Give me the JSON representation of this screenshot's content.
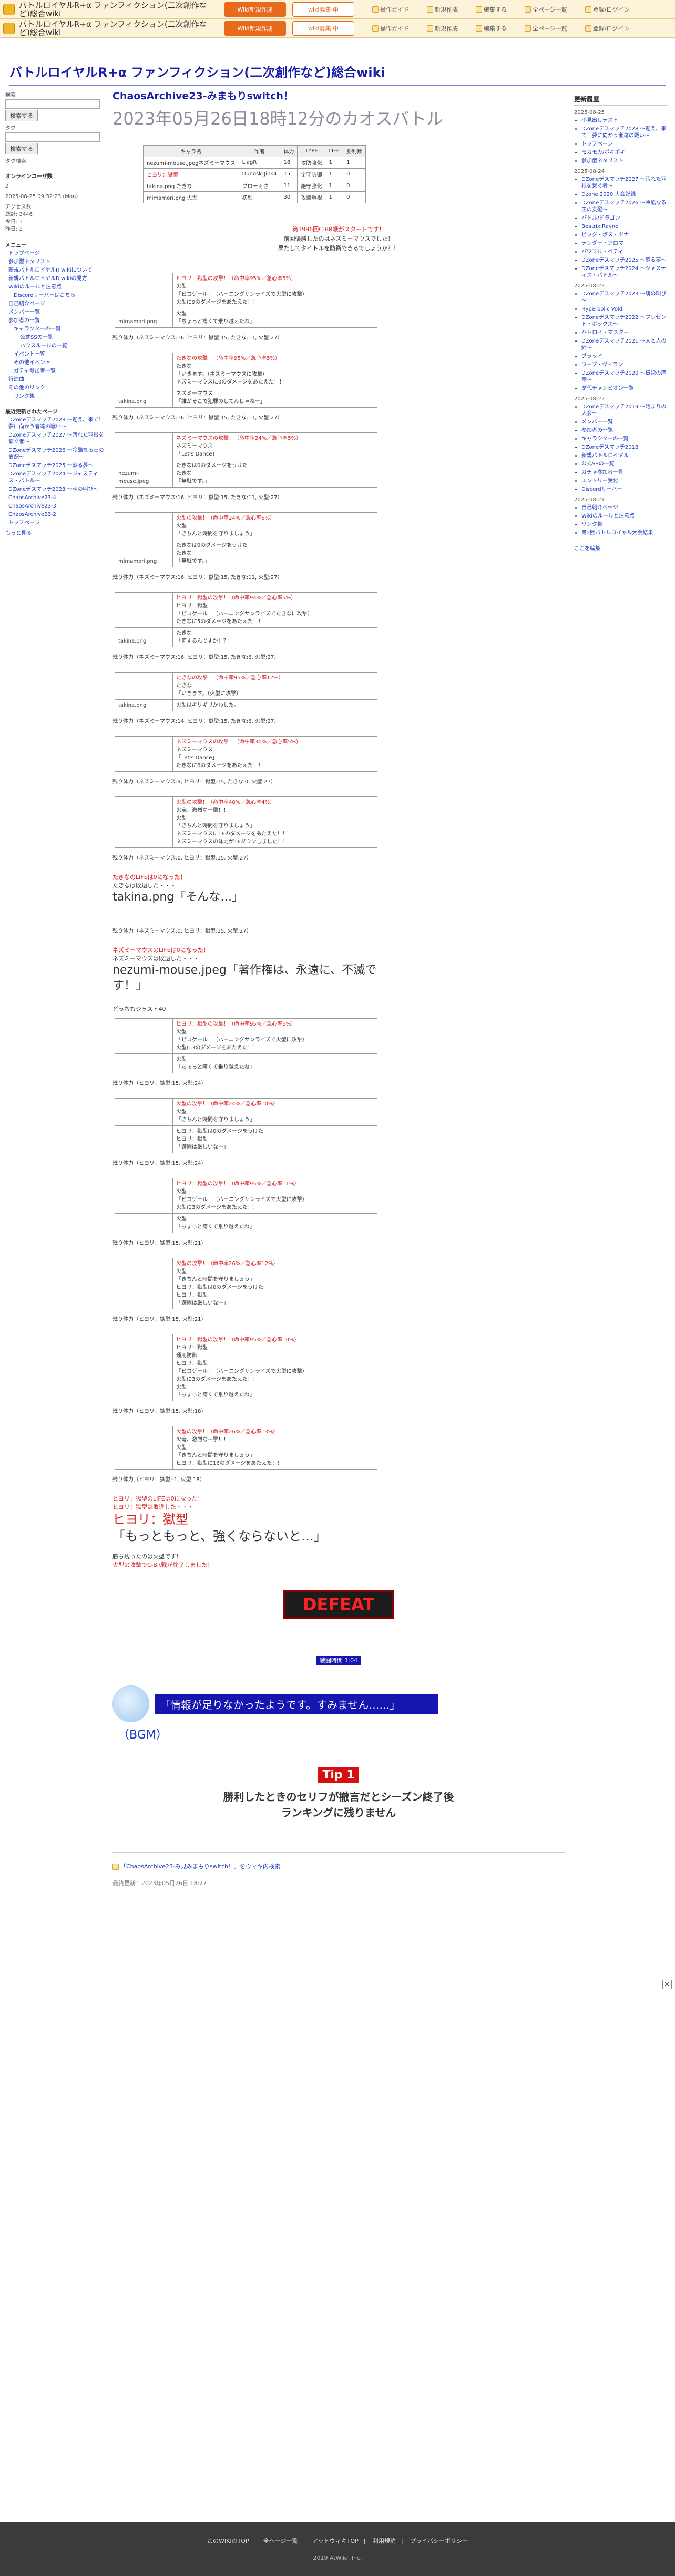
{
  "topbar": {
    "site_title": "バトルロイヤルR+α ファンフィクション(二次創作など)総合wiki",
    "tab1": "Wiki新規作成",
    "tab2": "wiki募集 中",
    "tab3": "登録/ログイン",
    "tools": [
      "操作ガイド",
      "新規作成",
      "編集する",
      "全ページ一覧",
      "登録/ログイン"
    ]
  },
  "wiki_title": "バトルロイヤルR+α ファンフィクション(二次創作など)総合wiki",
  "left": {
    "search_label": "検索",
    "search_button": "検索する",
    "filter_label": "タグ",
    "filter_button": "検索する",
    "tag_search": "タグ検索",
    "online_label": "オンラインユーザ数",
    "online_value": "2",
    "updated": "2025-08-25 09:32:23 (Mon)",
    "stats": [
      "アクセス数",
      "総計: 3446",
      "今日: 1",
      "昨日: 2"
    ],
    "menu_title": "メニュー",
    "menu": [
      "トップページ",
      "参加型ネタリスト",
      "新規バトルロイヤルR wikiについて",
      "新規バトルロイヤルR wikiの見方",
      "Wikiのルールと注意点",
      "Discordサーバーはこちら",
      "自己紹介ページ",
      "メンバー一覧",
      "参加者の一覧",
      "キャラクターの一覧",
      "公式SSの一覧",
      "ハウスルールの一覧",
      "イベント一覧",
      "その他イベント",
      "ガチャ参加者一覧",
      "行進曲",
      "その他のリンク",
      "リンク集"
    ],
    "recent_title": "最近更新されたページ",
    "recent": [
      "DZoneデスマッチ2028 ～迎え、来て！夢に向かう者達の戦い～",
      "DZoneデスマッチ2027 ～汚れた羽根を繋ぐ者～",
      "DZoneデスマッチ2026 ～冷酷なる王の支配～",
      "DZoneデスマッチ2025 ～蘇る夢～",
      "DZoneデスマッチ2024 ～ジャスティス・バトル～",
      "DZoneデスマッチ2023 ～魂の叫び～",
      "ChaosArchive23-4",
      "ChaosArchive23-3",
      "ChaosArchive23-2",
      "トップページ"
    ],
    "more": "もっと見る"
  },
  "right": {
    "head": "更新履歴",
    "groups": [
      {
        "date": "2025-08-25",
        "items": [
          "小見出しテスト",
          "DZoneデスマッチ2028 ～迎え、来て！夢に向かう者達の戦い～",
          "トップページ",
          "モカモカ/ポキポキ",
          "参加型ネタリスト"
        ]
      },
      {
        "date": "2025-08-24",
        "items": [
          "DZoneデスマッチ2027 ～汚れた羽根を繋ぐ者～",
          "Dzone 2020 大会記録",
          "DZoneデスマッチ2026 ～冷酷なる王の支配～",
          "バトル/ドラゴン",
          "Beatrix Rayne",
          "ビッグ・ボス・ツナ",
          "テンダー・アロマ",
          "パワフル・ペティ",
          "DZoneデスマッチ2025 ～蘇る夢～",
          "DZoneデスマッチ2024 ～ジャスティス・バトル～"
        ]
      },
      {
        "date": "2025-08-23",
        "items": [
          "DZoneデスマッチ2023 ～魂の叫び～",
          "Hyperbolic Void",
          "DZoneデスマッチ2022 ～プレゼント・ボックス～",
          "バトロイ・マスター",
          "DZoneデスマッチ2021 ～人と人の絆～",
          "ブラッド",
          "ワープ・ヴィラン",
          "DZoneデスマッチ2020 ～伝説の序章～",
          "歴代チャンピオン一覧"
        ]
      },
      {
        "date": "2025-08-22",
        "items": [
          "DZoneデスマッチ2019 ～始まりの大会～",
          "メンバー一覧",
          "参加者の一覧",
          "キャラクターの一覧",
          "DZoneデスマッチ2018",
          "新規バトルロイヤル",
          "公式SSの一覧",
          "ガチャ参加者一覧",
          "エントリー受付",
          "Discordサーバー"
        ]
      },
      {
        "date": "2025-08-21",
        "items": [
          "自己紹介ページ",
          "Wikiのルールと注意点",
          "リンク集",
          "第2回バトルロイヤル大会結果"
        ]
      }
    ],
    "edit_link": "ここを編集"
  },
  "main": {
    "page_title": "ChaosArchive23-みまもりswitch！",
    "page_subtitle": "2023年05月26日18時12分のカオスバトル",
    "stat_headers": [
      "キャラ名",
      "作者",
      "体力",
      "TYPE",
      "LIFE",
      "勝利数"
    ],
    "stat_rows": [
      [
        "nezumi-mouse.jpegネズミーマウス",
        "LiagR",
        "18",
        "攻防強化",
        "1",
        "1"
      ],
      [
        "ヒヨリ：獄型",
        "Dunosk-Jink4",
        "15",
        "全守防御",
        "1",
        "0"
      ],
      [
        "takina.png たきな",
        "プロテぇさ",
        "11",
        "絶守強化",
        "1",
        "0"
      ],
      [
        "mimamori.png 火型",
        "初型",
        "30",
        "攻撃重視",
        "1",
        "0"
      ]
    ],
    "intro": [
      "第1996回C-BR戦がスタートです！",
      "前回優勝したのはネズミーマウスでした！",
      "果たしてタイトルを防衛できるでしょうか？！"
    ],
    "hp_lines": [
      "残り体力（ネズミーマウス:16, ヒヨリ：獄型:15, たきな:11, 火型:27）",
      "残り体力（ネズミーマウス:16, ヒヨリ：獄型:15, たきな:11, 火型:27）",
      "残り体力（ネズミーマウス:16, ヒヨリ：獄型:15, たきな:11, 火型:27）",
      "残り体力（ネズミーマウス:16, ヒヨリ：獄型:15, たきな:11, 火型:27）",
      "残り体力（ネズミーマウス:16, ヒヨリ：獄型:15, たきな:6, 火型:27）",
      "残り体力（ネズミーマウス:14, ヒヨリ：獄型:15, たきな:6, 火型:27）",
      "残り体力（ネズミーマウス:9, ヒヨリ：獄型:15, たきな:0, 火型:27）",
      "残り体力（ネズミーマウス:0, ヒヨリ：獄型:15, 火型:27）",
      "残り体力（ヒヨリ：獄型:15, 火型:24）",
      "残り体力（ヒヨリ：獄型:15, 火型:24）",
      "残り体力（ヒヨリ：獄型:15, 火型:21）",
      "残り体力（ヒヨリ：獄型:15, 火型:21）",
      "残り体力（ヒヨリ：獄型:15, 火型:18）",
      "残り体力（ヒヨリ：獄型:-1, 火型:18）"
    ],
    "turns": [
      {
        "lines": [
          "ヒヨリ：獄型の攻撃！（命中率95%／急心率5%）",
          "火型",
          "「ピコゲール！（ハーニングサンライズで火型に攻撃）",
          "火型に9のダメージをあたえた！！"
        ],
        "speaker": "mimamori.png",
        "reply": [
          "火型",
          "「ちょっと痛くて乗り越えたね」"
        ]
      },
      {
        "lines": [
          "たきなの攻撃！（命中率95%／急心率5%）",
          "たきな",
          "「いきます。（ネズミーマウスに攻撃）",
          "ネズミーマウスに0のダメージをあたえた！！"
        ],
        "speaker": "takina.png",
        "reply": [
          "ネズミーマウス",
          "「誰がそこで犯罪のしてんじゃねー」"
        ]
      },
      {
        "lines": [
          "ネズミーマウスの攻撃！（命中率24%／急心率5%）",
          "ネズミーマウス",
          "「Let's Dance」"
        ],
        "speaker": "nezumi-mouse.jpeg",
        "reply": [
          "たきなは0のダメージをうけた",
          "たきな",
          "「無駄です。」"
        ]
      },
      {
        "lines": [
          "火型の攻撃！（命中率24%／急心率5%）",
          "火型",
          "「きちんと時間を守りましょう」"
        ],
        "speaker": "mimamori.png",
        "reply": [
          "たきなは0のダメージをうけた",
          "たきな",
          "「無駄です。」"
        ]
      },
      {
        "lines": [
          "ヒヨリ：獄型の攻撃！（命中率94%／急心率5%）",
          "ヒヨリ：獄型",
          "「ピコゲール！（ハーニングサンライズでたきなに攻撃）",
          "たきなに5のダメージをあたえた！！"
        ],
        "speaker": "takina.png",
        "reply": [
          "たきな",
          "「何するんですか！？」"
        ]
      },
      {
        "lines": [
          "たきなの攻撃！（命中率95%／急心率12%）",
          "たきな",
          "「いきます。（火型に攻撃）"
        ],
        "speaker": "takina.png",
        "reply": [
          "火型はギリギリかわした。"
        ]
      },
      {
        "lines": [
          "ネズミーマウスの攻撃！（命中率30%／急心率5%）",
          "ネズミーマウス",
          "「Let's Dance」",
          "たきなに6のダメージをあたえた！！"
        ],
        "speaker": "nezumi-mouse.jpeg",
        "reply": []
      },
      {
        "lines": [
          "火型の攻撃！（命中率48%／急心率4%）",
          "火竜、激烈な一撃！！！",
          "火型",
          "「きちんと時間を守りましょう」",
          "ネズミーマウスに16のダメージをあたえた！！",
          "ネズミーマウスの体力が16ダウンしました！！"
        ],
        "speaker": "mimamori.png",
        "reply": []
      }
    ],
    "takina_out": [
      "たきなのLIFEは0になった！",
      "たきなは敗退した・・・"
    ],
    "takina_last": "takina.png「そんな…」",
    "mouse_out": [
      "ネズミーマウスのLIFEは0になった！",
      "ネズミーマウスは敗退した・・・"
    ],
    "mouse_last": "nezumi-mouse.jpeg「著作権は、永遠に、不滅です！」",
    "duel_label": "どっちもジャスト40",
    "duel_turns": [
      {
        "lines": [
          "ヒヨリ：獄型の攻撃！（命中率95%／急心率5%）",
          "火型",
          "「ピコゲール！（ハーニングサンライズで火型に攻撃）",
          "火型に3のダメージをあたえた！！"
        ],
        "reply": [
          "火型",
          "「ちょっと痛くて乗り越えたね」"
        ]
      },
      {
        "lines": [
          "火型の攻撃！（命中率24%／急心率10%）",
          "火型",
          "「きちんと時間を守りましょう」"
        ],
        "reply": [
          "ヒヨリ：獄型は0のダメージをうけた",
          "ヒヨリ：獄型",
          "「遊園は厳しいなー」"
        ]
      },
      {
        "lines": [
          "ヒヨリ：獄型の攻撃！（命中率95%／急心率11%）",
          "火型",
          "「ピコゲール！（ハーニングサンライズで火型に攻撃）",
          "火型に3のダメージをあたえた！！"
        ],
        "reply": [
          "火型",
          "「ちょっと痛くて乗り越えたね」"
        ]
      },
      {
        "lines": [
          "火型の攻撃！（命中率26%／急心率12%）",
          "火型",
          "「きちんと時間を守りましょう」",
          "ヒヨリ：獄型は0のダメージをうけた",
          "ヒヨリ：獄型",
          "「遊園は厳しいなー」"
        ],
        "reply": []
      },
      {
        "lines": [
          "ヒヨリ：獄型の攻撃！（命中率95%／急心率10%）",
          "ヒヨリ：獄型",
          "通用防御",
          "ヒヨリ：獄型",
          "「ピコゲール！（ハーニングサンライズで火型に攻撃）",
          "火型に3のダメージをあたえた！！",
          "火型",
          "「ちょっと痛くて乗り越えたね」"
        ],
        "reply": []
      },
      {
        "lines": [
          "火型の攻撃！（命中率26%／急心率13%）",
          "火竜、激烈な一撃！！！",
          "火型",
          "「きちんと時間を守りましょう」",
          "ヒヨリ：獄型に16のダメージをあたえた！！"
        ],
        "reply": []
      }
    ],
    "hiyori_out": [
      "ヒヨリ：獄型のLIFEは0になった！",
      "ヒヨリ：獄型は敗退した・・・"
    ],
    "hiyori_last_name": "ヒヨリ：獄型",
    "hiyori_last": "「もっともっと、強くならないと…」",
    "winner_lines": [
      "勝ち残ったのは火型です！",
      "火型の攻撃でC-BR戦が終了しました！"
    ],
    "defeat": "DEFEAT",
    "banner": "戦闘時間 1:04",
    "bubble": "「情報が足りなかったようです。すみません……」",
    "bgm": "（BGM）",
    "tip_label": "Tip 1",
    "tip_text": [
      "勝利したときのセリフが撤言だとシーズン終了後",
      "ランキングに残りません"
    ],
    "bottom_link": "「ChaosArchive23-み見みまもりswitch！」をウィキ内検索",
    "last_updated": "最終更新：2023年05月26日 18:27"
  },
  "footer": {
    "links": [
      "このWIKIのTOP",
      "全ページ一覧",
      "アットウィキTOP",
      "利用規約",
      "プライバシーポリシー"
    ],
    "copy": "2019 AtWiki, Inc."
  }
}
